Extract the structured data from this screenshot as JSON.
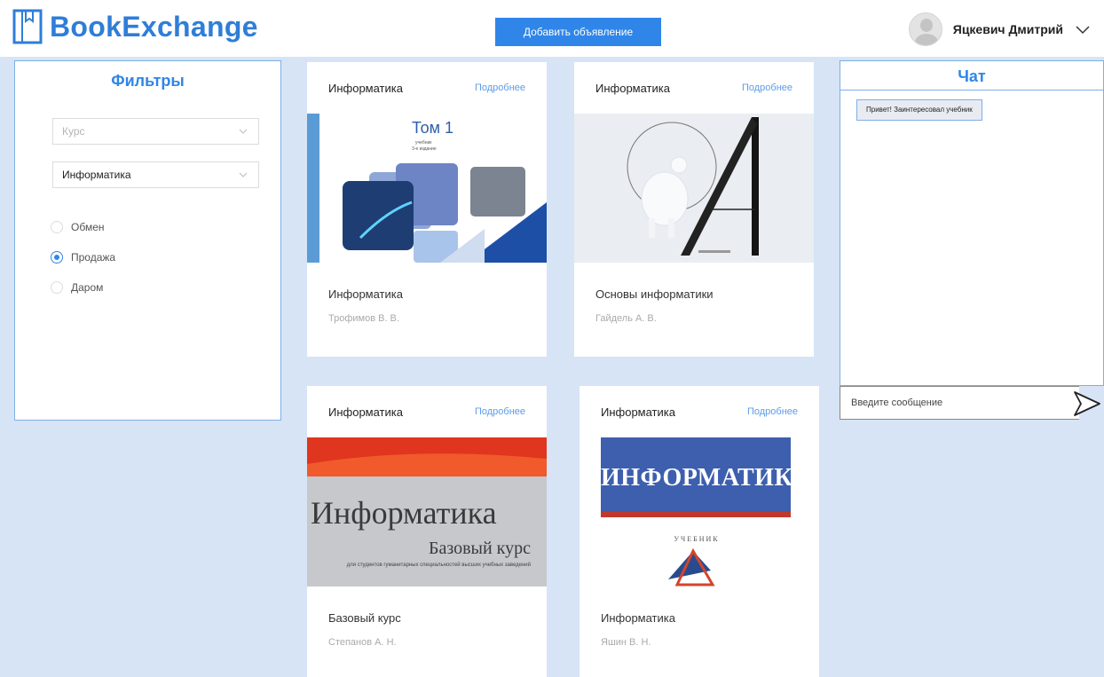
{
  "header": {
    "logo_text": "BookExchange",
    "add_button": "Добавить объявление",
    "user_name": "Яцкевич Дмитрий"
  },
  "filters": {
    "title": "Фильтры",
    "course_placeholder": "Курс",
    "subject_value": "Информатика",
    "options": [
      "Обмен",
      "Продажа",
      "Даром"
    ],
    "selected_option": "Продажа"
  },
  "cards": [
    {
      "category": "Информатика",
      "more": "Подробнее",
      "title": "Информатика",
      "author": "Трофимов В. В.",
      "cover_text": "Том 1",
      "cover_sub1": "учебник",
      "cover_sub2": "3-е издание"
    },
    {
      "category": "Информатика",
      "more": "Подробнее",
      "title": "Основы информатики",
      "author": "Гайдель А. В."
    },
    {
      "category": "Информатика",
      "more": "Подробнее",
      "title": "Базовый курс",
      "author": "Степанов А. Н.",
      "cover_text": "Информатика",
      "cover_sub1": "Базовый курс",
      "cover_sub2": "для студентов гуманитарных специальностей высших учебных заведений"
    },
    {
      "category": "Информатика",
      "more": "Подробнее",
      "title": "Информатика",
      "author": "Яшин В. Н.",
      "cover_text": "ИНФОРМАТИКА",
      "cover_sub1": "У Ч Е Б Н И К"
    }
  ],
  "chat": {
    "title": "Чат",
    "message": "Привет! Заинтересовал учебник",
    "input_placeholder": "Введите сообщение"
  },
  "colors": {
    "accent": "#2f86e8",
    "background": "#d6e4f5",
    "border": "#7eaee6"
  }
}
